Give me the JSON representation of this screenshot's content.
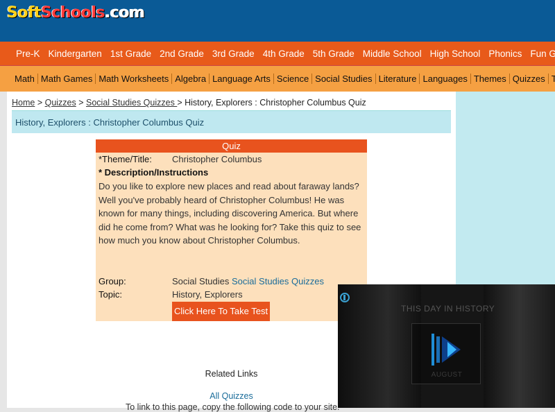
{
  "logo": {
    "text_1": "Soft",
    "text_2": "Schools",
    "text_3": ".com"
  },
  "nav_primary": [
    "Pre-K",
    "Kindergarten",
    "1st Grade",
    "2nd Grade",
    "3rd Grade",
    "4th Grade",
    "5th Grade",
    "Middle School",
    "High School",
    "Phonics",
    "Fun Games"
  ],
  "nav_secondary": [
    "Math",
    "Math Games",
    "Math Worksheets",
    "Algebra",
    "Language Arts",
    "Science",
    "Social Studies",
    "Literature",
    "Languages",
    "Themes",
    "Quizzes",
    "Timelines"
  ],
  "breadcrumb": {
    "home": "Home",
    "quizzes": "Quizzes",
    "social_studies_quizzes": "Social Studies Quizzes ",
    "current": "History, Explorers : Christopher Columbus Quiz",
    "separator": " > "
  },
  "page_title": "History, Explorers : Christopher Columbus Quiz",
  "quiz": {
    "header": "Quiz",
    "theme_label": "*Theme/Title:",
    "theme_value": "Christopher Columbus",
    "desc_label": "* Description/Instructions",
    "description": "Do you like to explore new places and read about faraway lands? Well you've probably heard of Christopher Columbus! He was known for many things, including discovering America. But where did he come from? What was he looking for? Take this quiz to see how much you know about Christopher Columbus.",
    "group_label": "Group:",
    "group_value": "Social Studies",
    "group_link": "Social Studies Quizzes",
    "topic_label": "Topic:",
    "topic_value": "History, Explorers",
    "button_label": "Click Here To Take Test"
  },
  "related": {
    "title": "Related Links",
    "all_quizzes": "All Quizzes",
    "link_to": "To link to this page, copy the following code to your site:"
  },
  "video": {
    "heading": "THIS DAY IN HISTORY",
    "month": "AUGUST"
  },
  "colors": {
    "header_blue": "#0a5a96",
    "nav_orange": "#e85a1a",
    "nav_light_orange": "#f5a042",
    "quiz_bg": "#fde0bc",
    "accent_blue": "#1a6c9a"
  }
}
